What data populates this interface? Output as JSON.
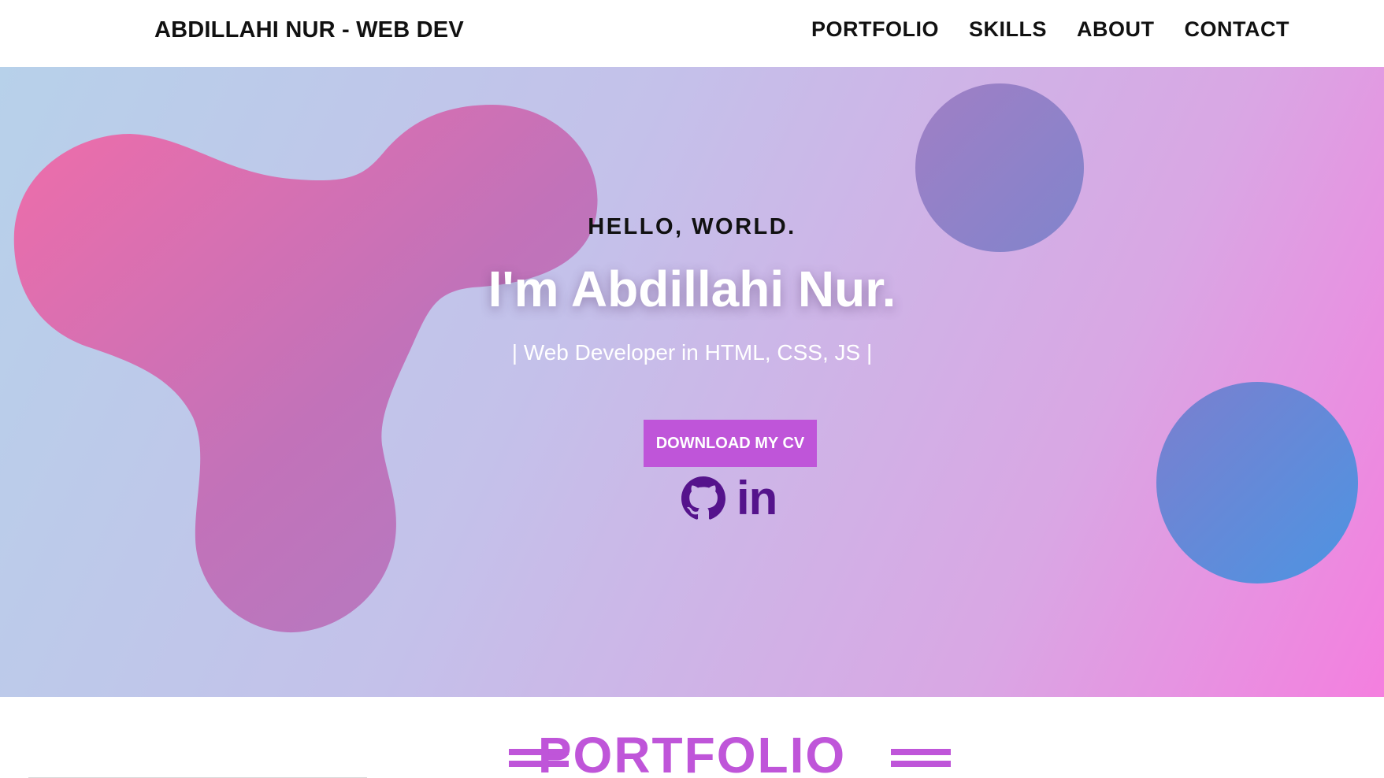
{
  "header": {
    "brand": "ABDILLAHI NUR - WEB DEV",
    "nav": [
      "PORTFOLIO",
      "SKILLS",
      "ABOUT",
      "CONTACT"
    ]
  },
  "hero": {
    "greeting": "HELLO, WORLD.",
    "headline": "I'm Abdillahi Nur.",
    "subtitle": "| Web Developer in HTML, CSS, JS |",
    "cta_label": "DOWNLOAD MY CV",
    "social": [
      {
        "icon": "github-icon"
      },
      {
        "icon": "linkedin-icon",
        "text": "in"
      }
    ]
  },
  "portfolio": {
    "title": "PORTFOLIO"
  },
  "colors": {
    "accent": "#bf55d9",
    "social_icon": "#55138c",
    "hero_gradient_start": "#b7d1ea",
    "hero_gradient_end": "#f47fdf",
    "blob": "#d56ec1"
  }
}
